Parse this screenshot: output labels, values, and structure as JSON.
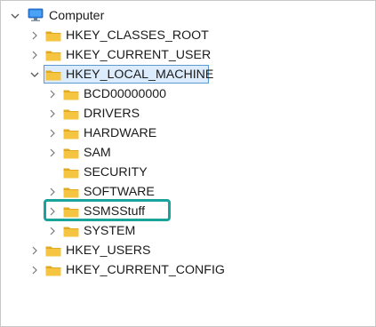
{
  "tree": {
    "root": {
      "label": "Computer",
      "icon": "computer-icon",
      "expanded": true
    },
    "hives": [
      {
        "label": "HKEY_CLASSES_ROOT",
        "expanded": false
      },
      {
        "label": "HKEY_CURRENT_USER",
        "expanded": false
      },
      {
        "label": "HKEY_LOCAL_MACHINE",
        "expanded": true,
        "selected": true
      },
      {
        "label": "HKEY_USERS",
        "expanded": false
      },
      {
        "label": "HKEY_CURRENT_CONFIG",
        "expanded": false
      }
    ],
    "hklm_children": [
      {
        "label": "BCD00000000",
        "has_children": true
      },
      {
        "label": "DRIVERS",
        "has_children": true
      },
      {
        "label": "HARDWARE",
        "has_children": true
      },
      {
        "label": "SAM",
        "has_children": true
      },
      {
        "label": "SECURITY",
        "has_children": false
      },
      {
        "label": "SOFTWARE",
        "has_children": true
      },
      {
        "label": "SSMSStuff",
        "has_children": true,
        "highlighted": true
      },
      {
        "label": "SYSTEM",
        "has_children": true
      }
    ]
  },
  "colors": {
    "folder": "#f5c542",
    "folder_dark": "#e2a820",
    "selection_bg": "#dcecfc",
    "selection_border": "#5b9bd5",
    "highlight": "#1aa39a",
    "monitor": "#2b7de0"
  }
}
